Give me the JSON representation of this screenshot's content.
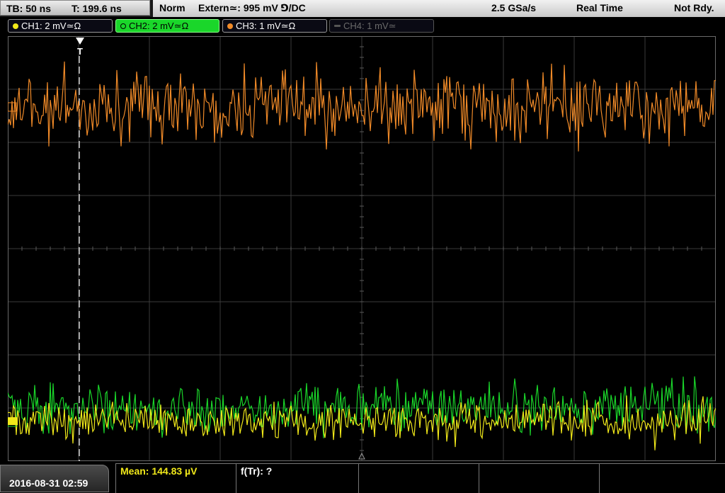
{
  "timebase": {
    "tb": "TB: 50 ns",
    "t": "T: 199.6 ns"
  },
  "status": {
    "mode": "Norm",
    "trigger": "Extern≃: 995 mV ⅁/DC",
    "sample_rate": "2.5 GSa/s",
    "acq": "Real Time",
    "state": "Not Rdy."
  },
  "channels": [
    {
      "label": "CH1: 2 mV≃Ω",
      "color": "#f0e81a",
      "active": false,
      "enabled": true
    },
    {
      "label": "CH2: 2 mV≃Ω",
      "color": "#1ad62a",
      "active": true,
      "enabled": true
    },
    {
      "label": "CH3: 1 mV≃Ω",
      "color": "#f08a28",
      "active": false,
      "enabled": true
    },
    {
      "label": "CH4: 1 mV≃",
      "color": "#555555",
      "active": false,
      "enabled": false
    }
  ],
  "trigger_marker": "T",
  "trace_colors": {
    "ch1": "#f0e81a",
    "ch2": "#1ad62a",
    "ch3": "#f08a28",
    "grid": "#3a3a3a"
  },
  "datetime": "2016-08-31 02:59",
  "measurements": {
    "mean": "Mean: 144.83 µV",
    "ftr": "f(Tr): ?"
  }
}
